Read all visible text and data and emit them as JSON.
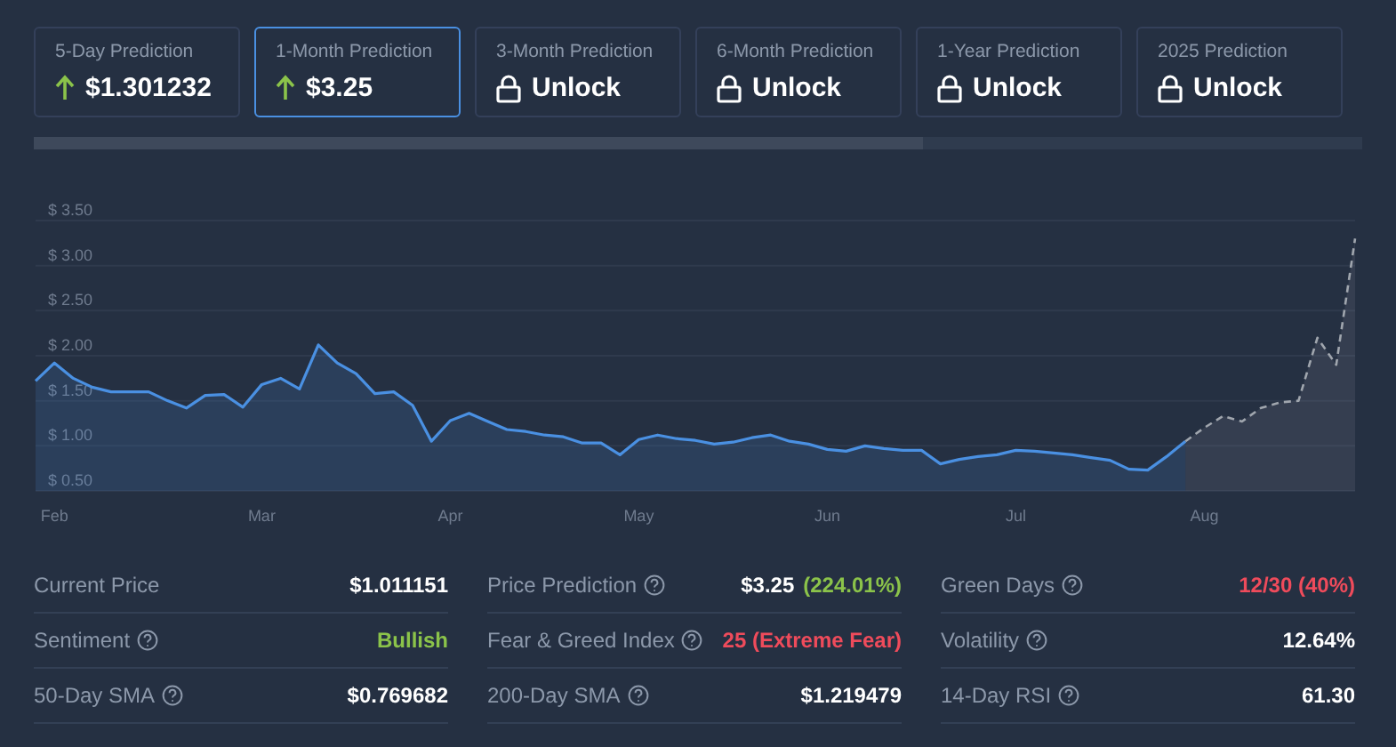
{
  "predictions": [
    {
      "label": "5-Day Prediction",
      "kind": "up",
      "value": "$1.301232",
      "selected": false
    },
    {
      "label": "1-Month Prediction",
      "kind": "up",
      "value": "$3.25",
      "selected": true
    },
    {
      "label": "3-Month Prediction",
      "kind": "locked",
      "value": "Unlock",
      "selected": false
    },
    {
      "label": "6-Month Prediction",
      "kind": "locked",
      "value": "Unlock",
      "selected": false
    },
    {
      "label": "1-Year Prediction",
      "kind": "locked",
      "value": "Unlock",
      "selected": false
    },
    {
      "label": "2025 Prediction",
      "kind": "locked",
      "value": "Unlock",
      "selected": false
    }
  ],
  "chart": {
    "chart_data": {
      "type": "area",
      "grid": true,
      "ylim": [
        0.5,
        3.5
      ],
      "yticks": [
        {
          "value": 0.5,
          "label": "$ 0.50"
        },
        {
          "value": 1,
          "label": "$ 1.00"
        },
        {
          "value": 1.5,
          "label": "$ 1.50"
        },
        {
          "value": 2,
          "label": "$ 2.00"
        },
        {
          "value": 2.5,
          "label": "$ 2.50"
        },
        {
          "value": 3,
          "label": "$ 3.00"
        },
        {
          "value": 3.5,
          "label": "$ 3.50"
        }
      ],
      "categories": [
        null,
        "Feb",
        null,
        null,
        null,
        null,
        null,
        null,
        null,
        null,
        null,
        null,
        "Mar",
        null,
        null,
        null,
        null,
        null,
        null,
        null,
        null,
        null,
        "Apr",
        null,
        null,
        null,
        null,
        null,
        null,
        null,
        null,
        null,
        "May",
        null,
        null,
        null,
        null,
        null,
        null,
        null,
        null,
        null,
        "Jun",
        null,
        null,
        null,
        null,
        null,
        null,
        null,
        null,
        null,
        "Jul",
        null,
        null,
        null,
        null,
        null,
        null,
        null,
        null,
        null,
        "Aug",
        null,
        null,
        null,
        null,
        null,
        null,
        null,
        null
      ],
      "series": [
        {
          "color": "#4a90e2",
          "values": [
            1.72,
            1.92,
            1.75,
            1.65,
            1.6,
            1.6,
            1.6,
            1.5,
            1.42,
            1.56,
            1.57,
            1.43,
            1.68,
            1.75,
            1.63,
            2.12,
            1.92,
            1.8,
            1.58,
            1.6,
            1.45,
            1.05,
            1.28,
            1.36,
            1.27,
            1.18,
            1.16,
            1.12,
            1.1,
            1.03,
            1.03,
            0.9,
            1.07,
            1.12,
            1.08,
            1.06,
            1.02,
            1.04,
            1.09,
            1.12,
            1.05,
            1.02,
            0.96,
            0.94,
            1.0,
            0.97,
            0.95,
            0.95,
            0.8,
            0.85,
            0.88,
            0.9,
            0.95,
            0.94,
            0.92,
            0.9,
            0.87,
            0.84,
            0.74,
            0.73,
            0.88,
            1.05,
            null,
            null,
            null,
            null,
            null,
            null,
            null,
            null,
            null
          ]
        },
        {
          "color": "#a0a6ae",
          "values": [
            null,
            null,
            null,
            null,
            null,
            null,
            null,
            null,
            null,
            null,
            null,
            null,
            null,
            null,
            null,
            null,
            null,
            null,
            null,
            null,
            null,
            null,
            null,
            null,
            null,
            null,
            null,
            null,
            null,
            null,
            null,
            null,
            null,
            null,
            null,
            null,
            null,
            null,
            null,
            null,
            null,
            null,
            null,
            null,
            null,
            null,
            null,
            null,
            null,
            null,
            null,
            null,
            null,
            null,
            null,
            null,
            null,
            null,
            null,
            null,
            null,
            1.05,
            1.2,
            1.33,
            1.27,
            1.42,
            1.48,
            1.5,
            2.2,
            1.9,
            3.3
          ]
        }
      ]
    }
  },
  "stats": [
    [
      {
        "label": "Current Price",
        "help": false,
        "value": "$1.011151",
        "color": "#ffffff"
      },
      {
        "label": "Sentiment",
        "help": true,
        "value": "Bullish",
        "color": "#8bc34a"
      },
      {
        "label": "50-Day SMA",
        "help": true,
        "value": "$0.769682",
        "color": "#ffffff"
      }
    ],
    [
      {
        "label": "Price Prediction",
        "help": true,
        "value": "$3.25",
        "color": "#ffffff",
        "note": {
          "text": "(224.01%)",
          "color": "#8bc34a"
        }
      },
      {
        "label": "Fear & Greed Index",
        "help": true,
        "value": "25 (Extreme Fear)",
        "color": "#ef4b5b"
      },
      {
        "label": "200-Day SMA",
        "help": true,
        "value": "$1.219479",
        "color": "#ffffff"
      }
    ],
    [
      {
        "label": "Green Days",
        "help": true,
        "value": "12/30 (40%)",
        "color": "#ef4b5b"
      },
      {
        "label": "Volatility",
        "help": true,
        "value": "12.64%",
        "color": "#ffffff"
      },
      {
        "label": "14-Day RSI",
        "help": true,
        "value": "61.30",
        "color": "#ffffff"
      }
    ]
  ]
}
